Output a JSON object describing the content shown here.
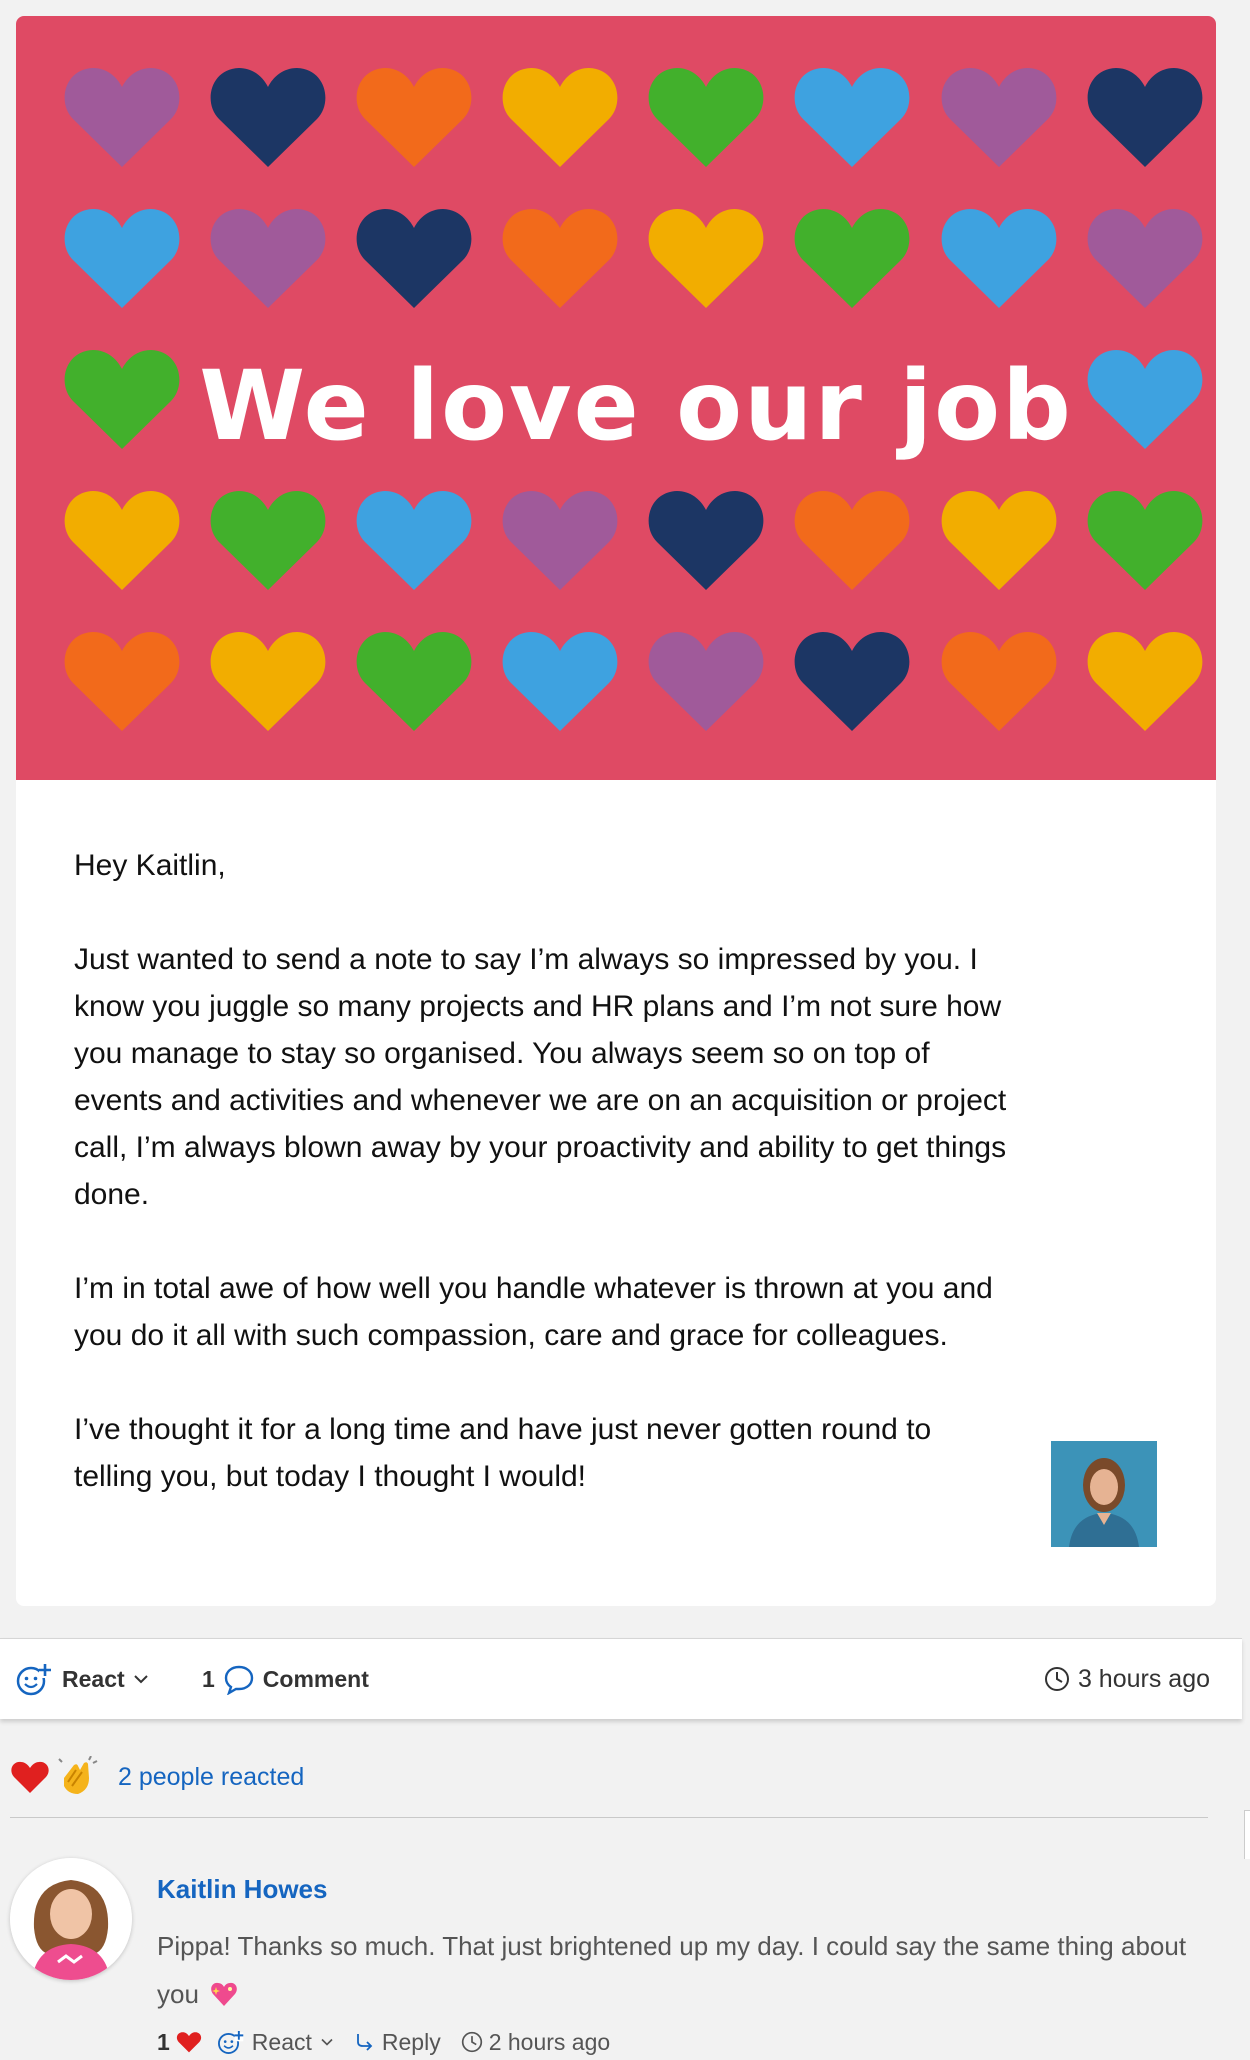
{
  "banner": {
    "title": "We love our job",
    "background": "#df4a64",
    "palette": {
      "purple": "#a05a9a",
      "navy": "#1c3664",
      "orange": "#f26a1b",
      "yellow": "#f2ad00",
      "green": "#42b02c",
      "blue": "#3ea2e0"
    },
    "heart_rows": [
      [
        "purple",
        "navy",
        "orange",
        "yellow",
        "green",
        "blue",
        "purple",
        "navy"
      ],
      [
        "blue",
        "purple",
        "navy",
        "orange",
        "yellow",
        "green",
        "blue",
        "purple"
      ],
      [
        "green",
        "",
        "",
        "",
        "",
        "",
        "",
        "blue"
      ],
      [
        "yellow",
        "green",
        "blue",
        "purple",
        "navy",
        "orange",
        "yellow",
        "green"
      ],
      [
        "orange",
        "yellow",
        "green",
        "blue",
        "purple",
        "navy",
        "orange",
        "yellow"
      ]
    ]
  },
  "message": {
    "greeting": "Hey Kaitlin,",
    "paragraphs": [
      "Just wanted to send a note to say I’m always so impressed by you. I know you juggle so many projects and HR plans and I’m not sure how you manage to stay so organised. You always seem so on top of events and activities and whenever we are on an acquisition or project call, I’m always blown away by your proactivity and ability to get things done.",
      "I’m in total awe of how well you handle whatever is thrown at you and you do it all with such compassion, care and grace for colleagues.",
      "I’ve thought it for a long time and have just never gotten round to telling you, but today I thought I would!"
    ]
  },
  "actions": {
    "react_label": "React",
    "comment_count": "1",
    "comment_label": "Comment",
    "time": "3 hours ago"
  },
  "reactions": {
    "icons": [
      "heart-emoji",
      "clap-emoji"
    ],
    "summary": "2 people reacted"
  },
  "comment": {
    "author": "Kaitlin Howes",
    "text": "Pippa! Thanks so much. That just brightened up my day. I could say the same thing about you",
    "emoji": "sparkling-heart-emoji",
    "reaction_count": "1",
    "react_label": "React",
    "reply_label": "Reply",
    "time": "2 hours ago"
  },
  "colors": {
    "link": "#1565c0",
    "heart_red": "#e0201f"
  }
}
